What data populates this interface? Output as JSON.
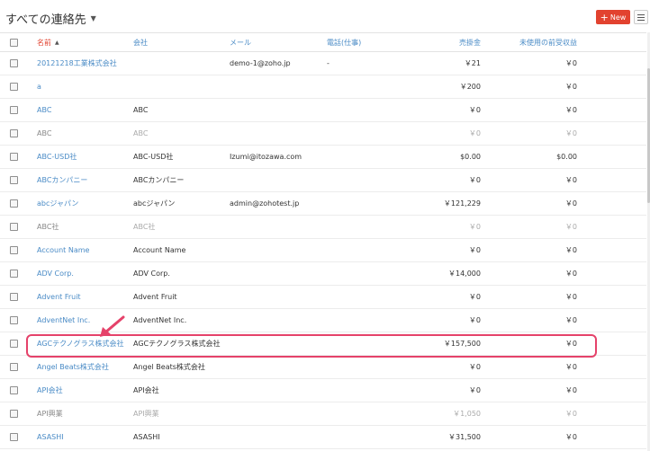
{
  "view": {
    "title": "すべての連絡先"
  },
  "toolbar": {
    "new_label": "New"
  },
  "columns": {
    "name": "名前",
    "company": "会社",
    "mail": "メール",
    "tel": "電話(仕事)",
    "sales": "売掛金",
    "unused": "未使用の前受収益"
  },
  "rows": [
    {
      "name": "20121218工業株式会社",
      "company": "",
      "mail": "demo-1@zoho.jp",
      "tel": "-",
      "sales": "￥21",
      "unused": "￥0",
      "muted": false
    },
    {
      "name": "a",
      "company": "",
      "mail": "",
      "tel": "",
      "sales": "￥200",
      "unused": "￥0",
      "muted": false
    },
    {
      "name": "ABC",
      "company": "ABC",
      "mail": "",
      "tel": "",
      "sales": "￥0",
      "unused": "￥0",
      "muted": false
    },
    {
      "name": "ABC",
      "company": "ABC",
      "mail": "",
      "tel": "",
      "sales": "￥0",
      "unused": "￥0",
      "muted": true
    },
    {
      "name": "ABC-USD社",
      "company": "ABC-USD社",
      "mail": "Izumi@itozawa.com",
      "tel": "",
      "sales": "$0.00",
      "unused": "$0.00",
      "muted": false
    },
    {
      "name": "ABCカンパニー",
      "company": "ABCカンパニー",
      "mail": "",
      "tel": "",
      "sales": "￥0",
      "unused": "￥0",
      "muted": false
    },
    {
      "name": "abcジャパン",
      "company": "abcジャパン",
      "mail": "admin@zohotest.jp",
      "tel": "",
      "sales": "￥121,229",
      "unused": "￥0",
      "muted": false
    },
    {
      "name": "ABC社",
      "company": "ABC社",
      "mail": "",
      "tel": "",
      "sales": "￥0",
      "unused": "￥0",
      "muted": true
    },
    {
      "name": "Account Name",
      "company": "Account Name",
      "mail": "",
      "tel": "",
      "sales": "￥0",
      "unused": "￥0",
      "muted": false
    },
    {
      "name": "ADV Corp.",
      "company": "ADV Corp.",
      "mail": "",
      "tel": "",
      "sales": "￥14,000",
      "unused": "￥0",
      "muted": false
    },
    {
      "name": "Advent Fruit",
      "company": "Advent Fruit",
      "mail": "",
      "tel": "",
      "sales": "￥0",
      "unused": "￥0",
      "muted": false
    },
    {
      "name": "AdventNet Inc.",
      "company": "AdventNet Inc.",
      "mail": "",
      "tel": "",
      "sales": "￥0",
      "unused": "￥0",
      "muted": false
    },
    {
      "name": "AGCテクノグラス株式会社",
      "company": "AGCテクノグラス株式会社",
      "mail": "",
      "tel": "",
      "sales": "￥157,500",
      "unused": "￥0",
      "muted": false
    },
    {
      "name": "Angel Beats株式会社",
      "company": "Angel Beats株式会社",
      "mail": "",
      "tel": "",
      "sales": "￥0",
      "unused": "￥0",
      "muted": false
    },
    {
      "name": "API会社",
      "company": "API会社",
      "mail": "",
      "tel": "",
      "sales": "￥0",
      "unused": "￥0",
      "muted": false
    },
    {
      "name": "API興業",
      "company": "API興業",
      "mail": "",
      "tel": "",
      "sales": "￥1,050",
      "unused": "￥0",
      "muted": true
    },
    {
      "name": "ASASHI",
      "company": "ASASHI",
      "mail": "",
      "tel": "",
      "sales": "￥31,500",
      "unused": "￥0",
      "muted": false
    }
  ],
  "colors": {
    "accent": "#e2422f",
    "link": "#4a8bc6",
    "highlight": "#e5426a"
  }
}
